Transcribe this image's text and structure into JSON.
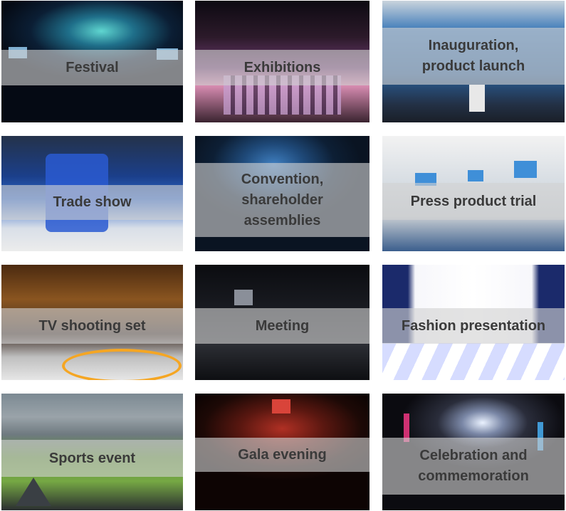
{
  "tiles": [
    {
      "label": "Festival"
    },
    {
      "label": "Exhibitions"
    },
    {
      "label": "Inauguration,\nproduct launch"
    },
    {
      "label": "Trade show"
    },
    {
      "label": "Convention,\nshareholder\nassemblies"
    },
    {
      "label": "Press product trial"
    },
    {
      "label": "TV shooting set"
    },
    {
      "label": "Meeting"
    },
    {
      "label": "Fashion presentation"
    },
    {
      "label": "Sports event"
    },
    {
      "label": "Gala evening"
    },
    {
      "label": "Celebration and\ncommemoration"
    }
  ]
}
